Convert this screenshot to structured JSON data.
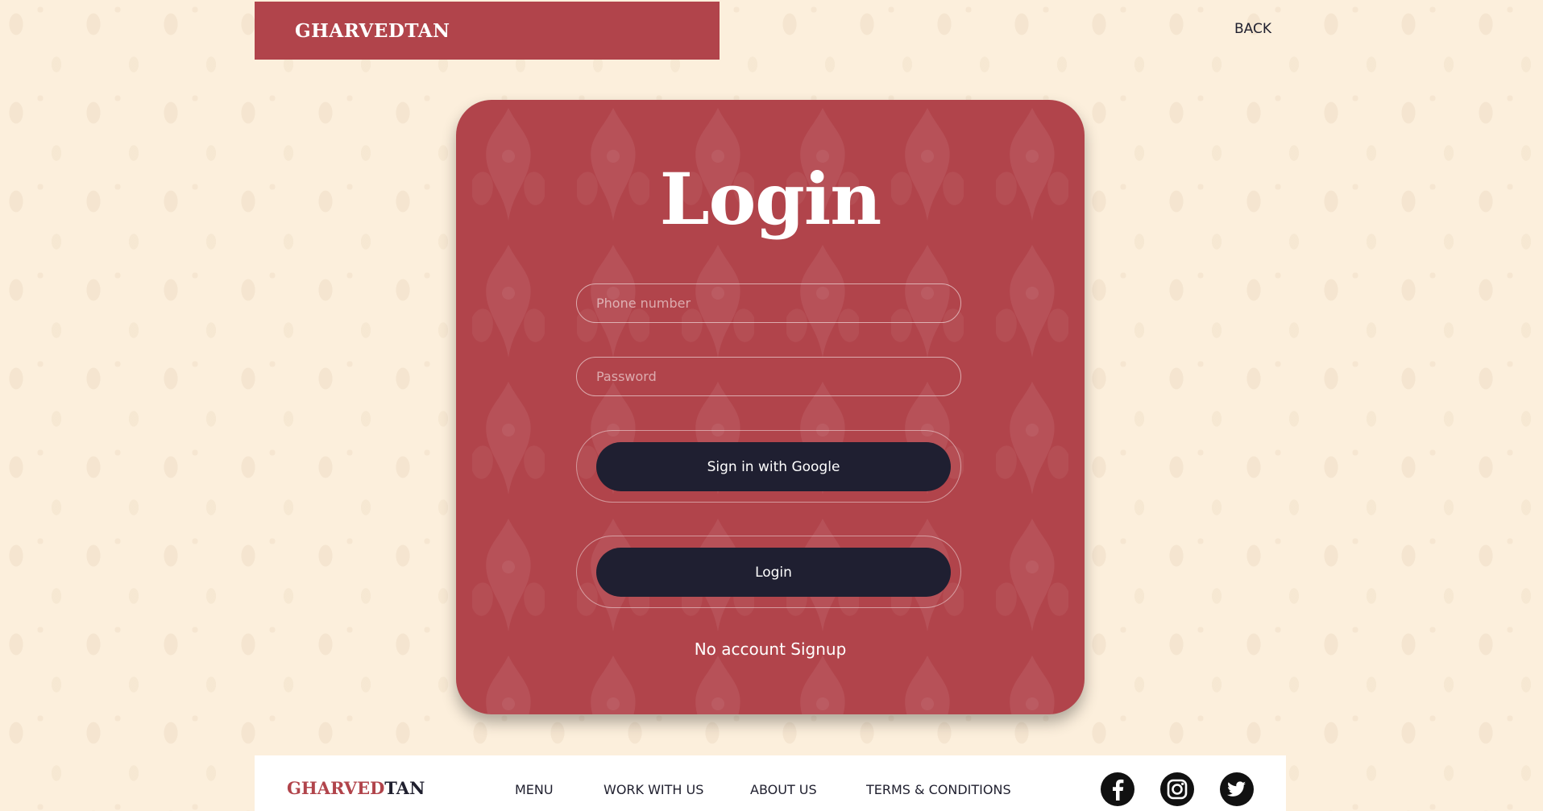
{
  "header": {
    "brand": "GHARVEDTAN",
    "back_label": "BACK"
  },
  "login_card": {
    "title": "Login",
    "phone_placeholder": "Phone number",
    "password_placeholder": "Password",
    "google_button": "Sign in with Google",
    "login_button": "Login",
    "signup_link": "No account Signup"
  },
  "footer": {
    "logo_part1": "GHARVED",
    "logo_part2": "TAN",
    "links": [
      "MENU",
      "WORK WITH US",
      "ABOUT US",
      "TERMS & CONDITIONS"
    ],
    "social_icons": [
      "facebook-icon",
      "instagram-icon",
      "twitter-icon"
    ]
  },
  "colors": {
    "brand_red": "#b1444b",
    "page_background": "#fcefdc",
    "button_dark": "#1f1f31",
    "text_dark": "#1f1f2e"
  }
}
